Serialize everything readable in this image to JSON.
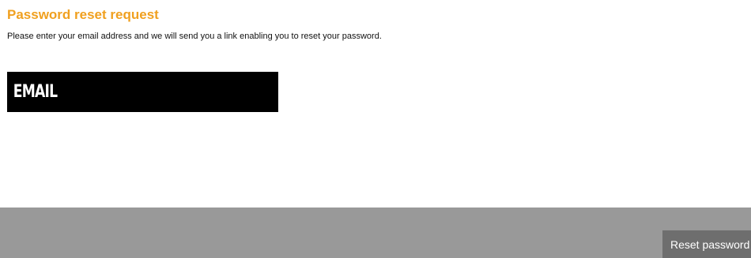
{
  "form": {
    "title": "Password reset request",
    "intro": "Please enter your email address and we will send you a link enabling you to reset your password.",
    "email": {
      "value": "",
      "placeholder": "EMAIL"
    }
  },
  "footer": {
    "reset_label": "Reset password"
  },
  "colors": {
    "title": "#f0a01f",
    "field_background": "#000000",
    "footer_background": "#999999",
    "button_background": "#6e6e6e"
  }
}
